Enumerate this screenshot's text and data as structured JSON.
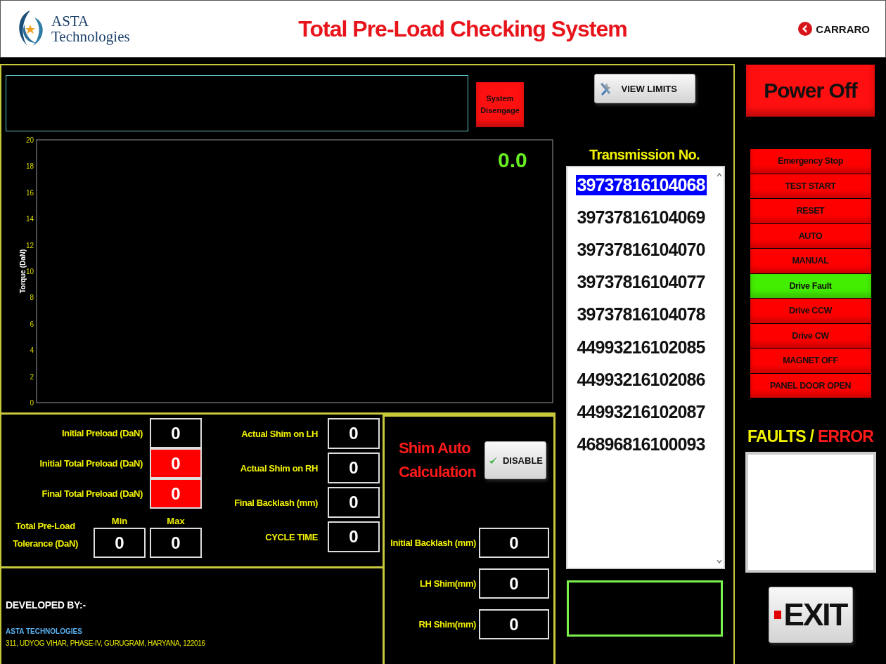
{
  "header": {
    "logo_line1": "ASTA",
    "logo_line2": "Technologies",
    "title": "Total Pre-Load Checking System",
    "brand": "CARRARO"
  },
  "disengage_button": "System Disengage",
  "chart": {
    "reading": "0.0",
    "axis_title": "Torque (DaN)",
    "tick_labels": [
      "20",
      "18",
      "16",
      "14",
      "12",
      "10",
      "8",
      "6",
      "4",
      "2",
      "0"
    ]
  },
  "view_limits_button": "VIEW LIMITS",
  "transmission": {
    "title": "Transmission No.",
    "items": [
      {
        "label": "39737816104068",
        "selected": true
      },
      {
        "label": "39737816104069",
        "selected": false
      },
      {
        "label": "39737816104070",
        "selected": false
      },
      {
        "label": "39737816104077",
        "selected": false
      },
      {
        "label": "39737816104078",
        "selected": false
      },
      {
        "label": "44993216102085",
        "selected": false
      },
      {
        "label": "44993216102086",
        "selected": false
      },
      {
        "label": "44993216102087",
        "selected": false
      },
      {
        "label": "46896816100093",
        "selected": false
      }
    ]
  },
  "preload_fields": [
    {
      "label": "Initial Preload (DaN)",
      "value": "0",
      "color": "#000000"
    },
    {
      "label": "Initial Total Preload (DaN)",
      "value": "0",
      "color": "#ff0000"
    },
    {
      "label": "Final Total Preload (DaN)",
      "value": "0",
      "color": "#ff0000"
    }
  ],
  "tolerance": {
    "label": "Total Pre-Load Tolerance (DaN)",
    "min_label": "Min",
    "max_label": "Max",
    "min": "0",
    "max": "0"
  },
  "shim_fields": [
    {
      "label": "Actual Shim on LH",
      "value": "0"
    },
    {
      "label": "Actual Shim on RH",
      "value": "0"
    },
    {
      "label": "Final Backlash (mm)",
      "value": "0"
    },
    {
      "label": "CYCLE TIME",
      "value": "0"
    }
  ],
  "developer": {
    "heading": "DEVELOPED BY:-",
    "company": "ASTA TECHNOLOGIES",
    "address": "311, UDYOG VIHAR, PHASE-IV, GURUGRAM, HARYANA, 122016"
  },
  "shim_auto": {
    "title": "Shim Auto Calculation",
    "button": "DISABLE",
    "fields": [
      {
        "label": "Initial Backlash (mm)",
        "value": "0"
      },
      {
        "label": "LH Shim(mm)",
        "value": "0"
      },
      {
        "label": "RH Shim(mm)",
        "value": "0"
      }
    ]
  },
  "power_button": "Power Off",
  "indicators": [
    {
      "label": "Emergency Stop",
      "color": "#ff0000"
    },
    {
      "label": "TEST START",
      "color": "#ff0000"
    },
    {
      "label": "RESET",
      "color": "#ff0000"
    },
    {
      "label": "AUTO",
      "color": "#ff0000"
    },
    {
      "label": "MANUAL",
      "color": "#ff0000"
    },
    {
      "label": "Drive Fault",
      "color": "#44ee00"
    },
    {
      "label": "Drive CCW",
      "color": "#ff0000"
    },
    {
      "label": "Drive CW",
      "color": "#ff0000"
    },
    {
      "label": "MAGNET OFF",
      "color": "#ff0000"
    },
    {
      "label": "PANEL DOOR OPEN",
      "color": "#ff0000"
    }
  ],
  "faults": {
    "label": "FAULTS /",
    "label_error": "ERROR"
  },
  "exit_button": "EXIT"
}
